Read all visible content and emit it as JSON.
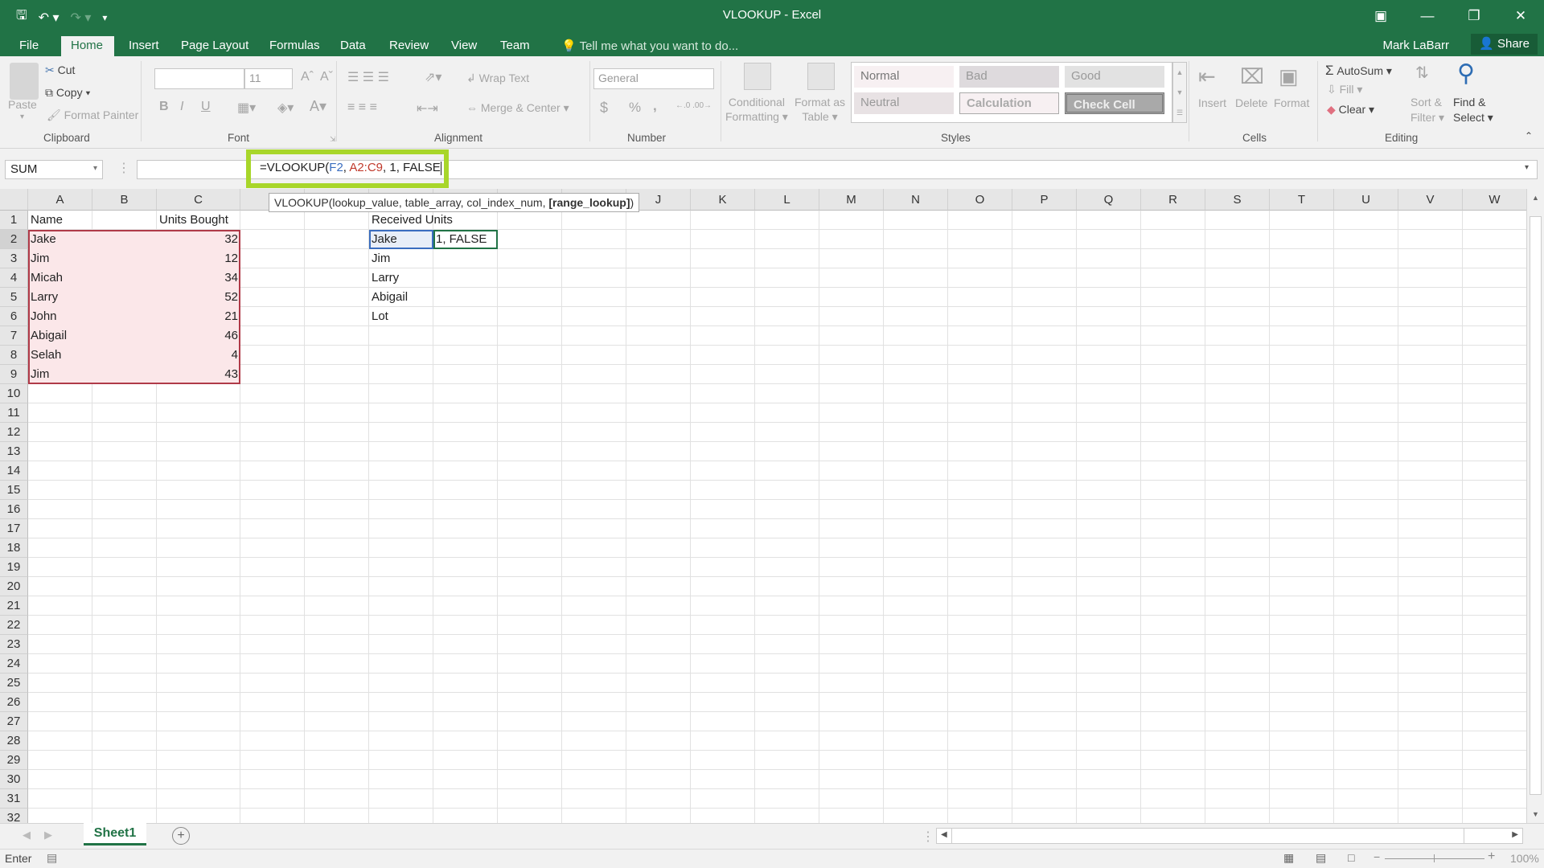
{
  "window": {
    "title": "VLOOKUP - Excel",
    "controls": [
      "ribbon-display-options",
      "minimize",
      "restore",
      "close"
    ]
  },
  "qat": {
    "save": "save-icon",
    "undo": "undo-icon",
    "redo": "redo-icon",
    "customize": "customize-icon"
  },
  "tabs": [
    {
      "label": "File"
    },
    {
      "label": "Home",
      "active": true
    },
    {
      "label": "Insert"
    },
    {
      "label": "Page Layout"
    },
    {
      "label": "Formulas"
    },
    {
      "label": "Data"
    },
    {
      "label": "Review"
    },
    {
      "label": "View"
    },
    {
      "label": "Team"
    }
  ],
  "tell_me": "Tell me what you want to do...",
  "user": "Mark LaBarr",
  "share": "Share",
  "ribbon": {
    "clipboard": {
      "label": "Clipboard",
      "paste": "Paste",
      "cut": "Cut",
      "copy": "Copy",
      "format_painter": "Format Painter"
    },
    "font": {
      "label": "Font",
      "font_name": "",
      "font_size": "11",
      "bold": "B",
      "italic": "I",
      "underline": "U"
    },
    "alignment": {
      "label": "Alignment",
      "wrap_text": "Wrap Text",
      "merge_center": "Merge & Center"
    },
    "number": {
      "label": "Number",
      "format": "General",
      "currency": "$",
      "percent": "%",
      "comma": ","
    },
    "styles": {
      "label": "Styles",
      "conditional_formatting": [
        "Conditional",
        "Formatting"
      ],
      "format_as_table": [
        "Format as",
        "Table"
      ],
      "cells": [
        "Normal",
        "Bad",
        "Good",
        "Neutral",
        "Calculation",
        "Check Cell"
      ]
    },
    "cells": {
      "label": "Cells",
      "insert": "Insert",
      "delete": "Delete",
      "format": "Format"
    },
    "editing": {
      "label": "Editing",
      "autosum": "AutoSum",
      "fill": "Fill",
      "clear": "Clear",
      "sort_filter": [
        "Sort &",
        "Filter"
      ],
      "find_select": [
        "Find &",
        "Select"
      ]
    }
  },
  "formula_bar": {
    "name_box": "SUM",
    "formula_parts": [
      {
        "text": "=VLOOKUP(",
        "color": "#222222"
      },
      {
        "text": "F2",
        "color": "#3a6dbf"
      },
      {
        "text": ", ",
        "color": "#222222"
      },
      {
        "text": "A2:C9",
        "color": "#c0392b"
      },
      {
        "text": ", 1, FALSE",
        "color": "#222222"
      }
    ],
    "tooltip": {
      "fn": "VLOOKUP(lookup_value, table_array, col_index_num, ",
      "bold": "[range_lookup]",
      "end": ")"
    }
  },
  "grid": {
    "columns": [
      "A",
      "B",
      "C",
      "D",
      "E",
      "F",
      "G",
      "H",
      "I",
      "J",
      "K",
      "L",
      "M",
      "N",
      "O",
      "P",
      "Q",
      "R",
      "S",
      "T",
      "U",
      "V",
      "W"
    ],
    "row_count": 32,
    "active_row": 2,
    "cells": {
      "A1": "Name",
      "C1": "Units Bought",
      "F1": "Received Units",
      "A2": "Jake",
      "C2": "32",
      "F2": "Jake",
      "G2": "1, FALSE",
      "A3": "Jim",
      "C3": "12",
      "F3": "Jim",
      "A4": "Micah",
      "C4": "34",
      "F4": "Larry",
      "A5": "Larry",
      "C5": "52",
      "F5": "Abigail",
      "A6": "John",
      "C6": "21",
      "F6": "Lot",
      "A7": "Abigail",
      "C7": "46",
      "A8": "Selah",
      "C8": "4",
      "A9": "Jim",
      "C9": "43"
    },
    "ref_colors": {
      "F2": "#3a6dbf",
      "A2:C9": "#b03a48",
      "active": "#217346"
    }
  },
  "sheets": [
    {
      "name": "Sheet1",
      "active": true
    }
  ],
  "status": {
    "mode": "Enter",
    "zoom": "100%"
  }
}
